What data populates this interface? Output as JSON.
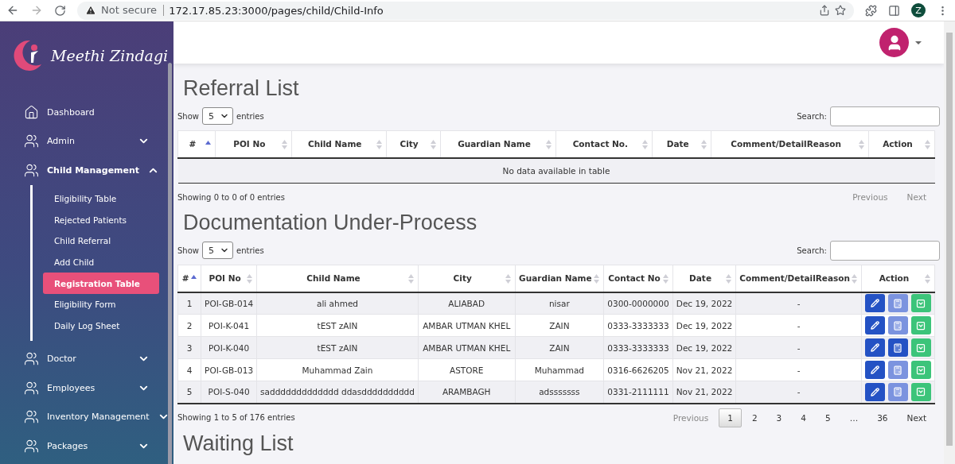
{
  "browser": {
    "security": "Not secure",
    "url": "172.17.85.23:3000/pages/child/Child-Info",
    "profile_initial": "Z"
  },
  "sidebar": {
    "brand": "Meethi Zindagi",
    "items": [
      {
        "label": "Dashboard",
        "kind": "home"
      },
      {
        "label": "Admin",
        "kind": "group",
        "expanded": false
      },
      {
        "label": "Child Management",
        "kind": "group",
        "expanded": true,
        "children": [
          {
            "label": "Eligibility Table",
            "selected": false
          },
          {
            "label": "Rejected Patients",
            "selected": false
          },
          {
            "label": "Child Referral",
            "selected": false
          },
          {
            "label": "Add Child",
            "selected": false
          },
          {
            "label": "Registration Table",
            "selected": true
          },
          {
            "label": "Eligibility Form",
            "selected": false
          },
          {
            "label": "Daily Log Sheet",
            "selected": false
          }
        ]
      },
      {
        "label": "Doctor",
        "kind": "group",
        "expanded": false
      },
      {
        "label": "Employees",
        "kind": "group",
        "expanded": false
      },
      {
        "label": "Inventory Management",
        "kind": "group",
        "expanded": false
      },
      {
        "label": "Packages",
        "kind": "group",
        "expanded": false
      }
    ]
  },
  "sections": [
    {
      "title": "Referral List",
      "show_label": "Show",
      "page_size": "5",
      "entries_label": "entries",
      "search_label": "Search:",
      "columns": [
        {
          "label": "#",
          "sorted": true
        },
        {
          "label": "POI No",
          "sorted": false
        },
        {
          "label": "Child Name",
          "sorted": false
        },
        {
          "label": "City",
          "sorted": false
        },
        {
          "label": "Guardian Name",
          "sorted": false
        },
        {
          "label": "Contact No.",
          "sorted": false
        },
        {
          "label": "Date",
          "sorted": false
        },
        {
          "label": "Comment/DetailReason",
          "sorted": false
        },
        {
          "label": "Action",
          "sorted": false
        }
      ],
      "empty_message": "No data available in table",
      "info": "Showing 0 to 0 of 0 entries",
      "pagination": {
        "previous": {
          "label": "Previous",
          "disabled": true
        },
        "next": {
          "label": "Next",
          "disabled": true
        }
      }
    },
    {
      "title": "Documentation Under-Process",
      "show_label": "Show",
      "page_size": "5",
      "entries_label": "entries",
      "search_label": "Search:",
      "columns": [
        {
          "label": "#",
          "sorted": true
        },
        {
          "label": "POI No",
          "sorted": false
        },
        {
          "label": "Child Name",
          "sorted": false
        },
        {
          "label": "City",
          "sorted": false
        },
        {
          "label": "Guardian Name",
          "sorted": false
        },
        {
          "label": "Contact No",
          "sorted": false
        },
        {
          "label": "Date",
          "sorted": false
        },
        {
          "label": "Comment/DetailReason",
          "sorted": false
        },
        {
          "label": "Action",
          "sorted": false
        }
      ],
      "rows": [
        {
          "cells": [
            "1",
            "POI-GB-014",
            "ali ahmed",
            "ALIABAD",
            "nisar",
            "0300-0000000",
            "Dec 19, 2022",
            "-"
          ],
          "calculator_active": false
        },
        {
          "cells": [
            "2",
            "POI-K-041",
            "tEST zAIN",
            "AMBAR UTMAN KHEL",
            "ZAIN",
            "0333-3333333",
            "Dec 19, 2022",
            "-"
          ],
          "calculator_active": false
        },
        {
          "cells": [
            "3",
            "POI-K-040",
            "tEST zAIN",
            "AMBAR UTMAN KHEL",
            "ZAIN",
            "0333-3333333",
            "Dec 19, 2022",
            "-"
          ],
          "calculator_active": true
        },
        {
          "cells": [
            "4",
            "POI-GB-013",
            "Muhammad Zain",
            "ASTORE",
            "Muhammad",
            "0316-6626205",
            "Nov 21, 2022",
            "-"
          ],
          "calculator_active": false
        },
        {
          "cells": [
            "5",
            "POI-S-040",
            "saddddddddddddd ddasdddddddddd",
            "ARAMBAGH",
            "adsssssss",
            "0331-2111111",
            "Nov 21, 2022",
            "-"
          ],
          "calculator_active": false
        }
      ],
      "info": "Showing 1 to 5 of 176 entries",
      "pagination": {
        "previous": {
          "label": "Previous",
          "disabled": true
        },
        "pages": [
          {
            "label": "1",
            "selected": true
          },
          {
            "label": "2",
            "selected": false
          },
          {
            "label": "3",
            "selected": false
          },
          {
            "label": "4",
            "selected": false
          },
          {
            "label": "5",
            "selected": false
          },
          {
            "label": "…",
            "selected": false
          },
          {
            "label": "36",
            "selected": false
          }
        ],
        "next": {
          "label": "Next",
          "disabled": false
        }
      }
    },
    {
      "title": "Waiting List"
    }
  ]
}
